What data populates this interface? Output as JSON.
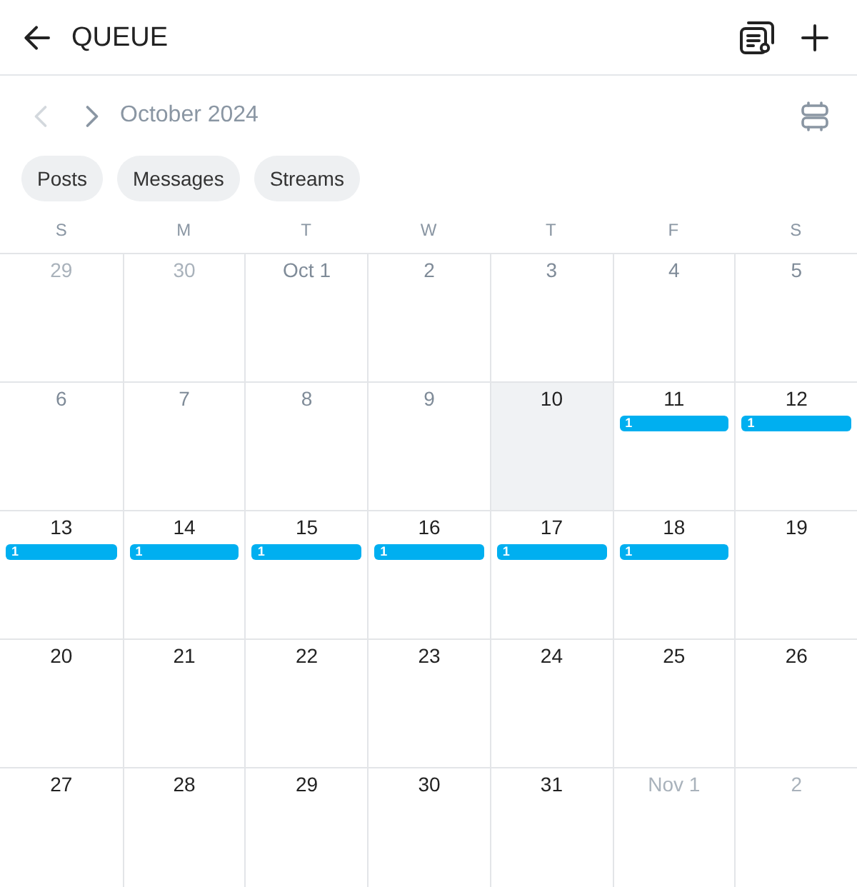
{
  "header": {
    "title": "QUEUE"
  },
  "month_nav": {
    "prev": {
      "disabled": true
    },
    "next": {
      "disabled": false
    },
    "label": "October 2024"
  },
  "filters": [
    {
      "label": "Posts",
      "selected": false
    },
    {
      "label": "Messages",
      "selected": false
    },
    {
      "label": "Streams",
      "selected": false
    }
  ],
  "calendar": {
    "weekdays": [
      "S",
      "M",
      "T",
      "W",
      "T",
      "F",
      "S"
    ],
    "weeks": [
      [
        {
          "date": "29",
          "kind": "outside"
        },
        {
          "date": "30",
          "kind": "outside"
        },
        {
          "date": "Oct 1",
          "kind": "past"
        },
        {
          "date": "2",
          "kind": "past"
        },
        {
          "date": "3",
          "kind": "past"
        },
        {
          "date": "4",
          "kind": "past"
        },
        {
          "date": "5",
          "kind": "past"
        }
      ],
      [
        {
          "date": "6",
          "kind": "past"
        },
        {
          "date": "7",
          "kind": "past"
        },
        {
          "date": "8",
          "kind": "past"
        },
        {
          "date": "9",
          "kind": "past"
        },
        {
          "date": "10",
          "kind": "today"
        },
        {
          "date": "11",
          "kind": "upcoming",
          "events": [
            {
              "count": "1"
            }
          ]
        },
        {
          "date": "12",
          "kind": "upcoming",
          "events": [
            {
              "count": "1"
            }
          ]
        }
      ],
      [
        {
          "date": "13",
          "kind": "upcoming",
          "events": [
            {
              "count": "1"
            }
          ]
        },
        {
          "date": "14",
          "kind": "upcoming",
          "events": [
            {
              "count": "1"
            }
          ]
        },
        {
          "date": "15",
          "kind": "upcoming",
          "events": [
            {
              "count": "1"
            }
          ]
        },
        {
          "date": "16",
          "kind": "upcoming",
          "events": [
            {
              "count": "1"
            }
          ]
        },
        {
          "date": "17",
          "kind": "upcoming",
          "events": [
            {
              "count": "1"
            }
          ]
        },
        {
          "date": "18",
          "kind": "upcoming",
          "events": [
            {
              "count": "1"
            }
          ]
        },
        {
          "date": "19",
          "kind": "upcoming"
        }
      ],
      [
        {
          "date": "20",
          "kind": "upcoming"
        },
        {
          "date": "21",
          "kind": "upcoming"
        },
        {
          "date": "22",
          "kind": "upcoming"
        },
        {
          "date": "23",
          "kind": "upcoming"
        },
        {
          "date": "24",
          "kind": "upcoming"
        },
        {
          "date": "25",
          "kind": "upcoming"
        },
        {
          "date": "26",
          "kind": "upcoming"
        }
      ],
      [
        {
          "date": "27",
          "kind": "upcoming"
        },
        {
          "date": "28",
          "kind": "upcoming"
        },
        {
          "date": "29",
          "kind": "upcoming"
        },
        {
          "date": "30",
          "kind": "upcoming"
        },
        {
          "date": "31",
          "kind": "upcoming"
        },
        {
          "date": "Nov 1",
          "kind": "outside"
        },
        {
          "date": "2",
          "kind": "outside"
        }
      ]
    ]
  }
}
